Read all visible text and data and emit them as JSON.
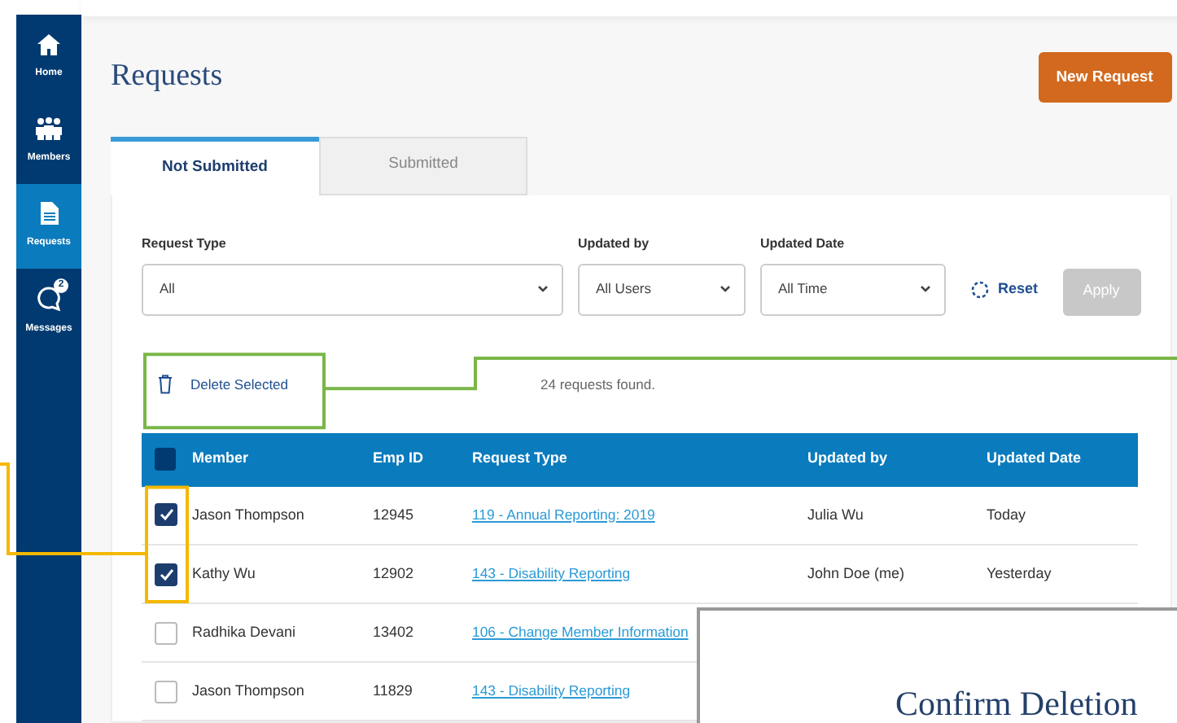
{
  "sidebar": {
    "items": [
      {
        "kind": "home",
        "label": "Home",
        "selected": false
      },
      {
        "kind": "members",
        "label": "Members",
        "selected": false
      },
      {
        "kind": "requests",
        "label": "Requests",
        "selected": true
      },
      {
        "kind": "messages",
        "label": "Messages",
        "selected": false,
        "badge": "2"
      }
    ]
  },
  "page": {
    "title": "Requests",
    "new_button": "New Request"
  },
  "tabs": [
    {
      "label": "Not Submitted",
      "selected": true
    },
    {
      "label": "Submitted",
      "selected": false
    }
  ],
  "filters": [
    {
      "label": "Request Type",
      "value": "All"
    },
    {
      "label": "Updated by",
      "value": "All Users"
    },
    {
      "label": "Updated Date",
      "value": "All Time"
    }
  ],
  "reset": "Reset",
  "apply": {
    "label": "Apply",
    "disabled": true
  },
  "delete_button": "Delete Selected",
  "result_count": "24 requests found.",
  "table": {
    "select_all_checked": false,
    "columns": [
      "Member",
      "Emp ID",
      "Request Type",
      "Updated by",
      "Updated Date"
    ],
    "rows": [
      {
        "checked": true,
        "member": "Jason Thompson",
        "emp_id": "12945",
        "request_type": "119 - Annual Reporting: 2019",
        "updated_by": "Julia Wu",
        "updated_date": "Today"
      },
      {
        "checked": true,
        "member": "Kathy Wu",
        "emp_id": "12902",
        "request_type": "143 - Disability Reporting",
        "updated_by": "John Doe (me)",
        "updated_date": "Yesterday"
      },
      {
        "checked": false,
        "member": "Radhika Devani",
        "emp_id": "13402",
        "request_type": "106 - Change Member Information"
      },
      {
        "checked": false,
        "member": "Jason Thompson",
        "emp_id": "11829",
        "request_type": "143 - Disability Reporting"
      }
    ]
  },
  "modal": {
    "title": "Confirm Deletion"
  },
  "annotations": [
    {
      "kind": "delete",
      "color": "#7ab648"
    },
    {
      "kind": "checkboxes",
      "color": "#f5b800"
    }
  ]
}
